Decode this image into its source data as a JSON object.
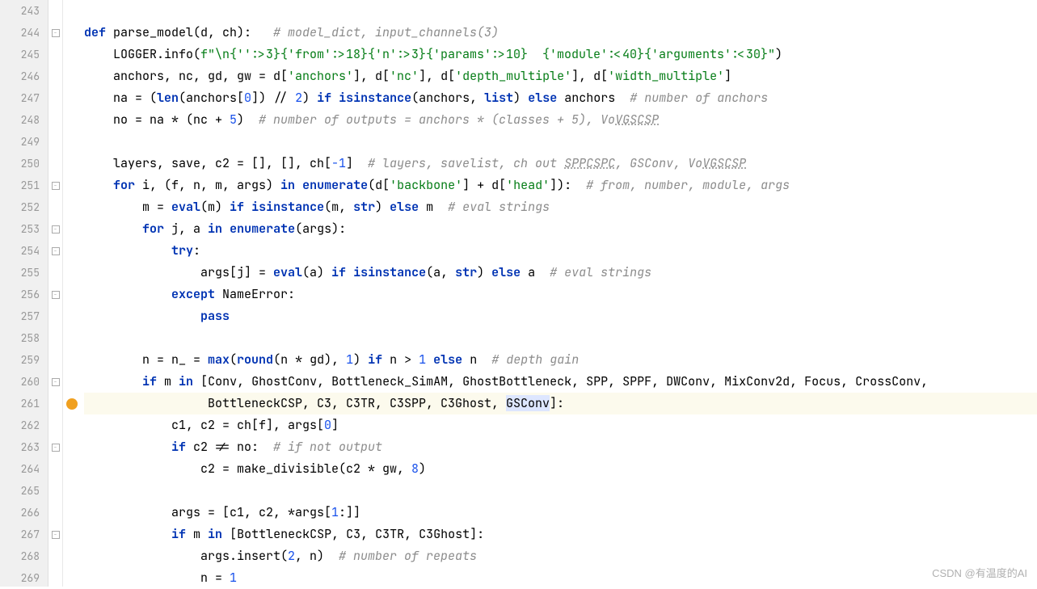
{
  "watermark": "CSDN @有温度的AI",
  "lines": [
    {
      "n": "243",
      "fold": "",
      "icon": "",
      "html": ""
    },
    {
      "n": "244",
      "fold": "box",
      "icon": "",
      "html": "<span class='kw'>def </span><span class='fn'>parse_model</span>(d, ch):   <span class='cm'># model_dict, input_channels(3)</span>"
    },
    {
      "n": "245",
      "fold": "",
      "icon": "",
      "html": "    LOGGER.info(<span class='str'>f\"\\n{'':&gt;3}{'from':&gt;18}{'n':&gt;3}{'params':&gt;10}  {'module':&lt;40}{'arguments':&lt;30}\"</span>)"
    },
    {
      "n": "246",
      "fold": "",
      "icon": "",
      "html": "    anchors, nc, gd, gw = d[<span class='str'>'anchors'</span>], d[<span class='str'>'nc'</span>], d[<span class='str'>'depth_multiple'</span>], d[<span class='str'>'width_multiple'</span>]"
    },
    {
      "n": "247",
      "fold": "",
      "icon": "",
      "html": "    na = (<span class='kw'>len</span>(anchors[<span class='num'>0</span>]) // <span class='num'>2</span>) <span class='kw'>if </span><span class='kw'>isinstance</span>(anchors, <span class='kw'>list</span>) <span class='kw'>else </span>anchors  <span class='cm'># number of anchors</span>"
    },
    {
      "n": "248",
      "fold": "",
      "icon": "",
      "html": "    no = na * (nc + <span class='num'>5</span>)  <span class='cm'># number of outputs = anchors * (classes + 5), Vo<span class='cm-u'>VGSCSP</span></span>"
    },
    {
      "n": "249",
      "fold": "",
      "icon": "",
      "html": ""
    },
    {
      "n": "250",
      "fold": "",
      "icon": "",
      "html": "    layers, save, c2 = [], [], ch[<span class='num'>-1</span>]  <span class='cm'># layers, savelist, ch out <span class='cm-u'>SPPCSPC</span>, GSConv, Vo<span class='cm-u'>VGSCSP</span></span>"
    },
    {
      "n": "251",
      "fold": "box",
      "icon": "",
      "html": "    <span class='kw'>for </span>i, (f, n, m, args) <span class='kw'>in </span><span class='kw'>enumerate</span>(d[<span class='str'>'backbone'</span>] + d[<span class='str'>'head'</span>]):  <span class='cm'># from, number, module, args</span>"
    },
    {
      "n": "252",
      "fold": "",
      "icon": "",
      "html": "        m = <span class='kw'>eval</span>(m) <span class='kw'>if </span><span class='kw'>isinstance</span>(m, <span class='kw'>str</span>) <span class='kw'>else </span>m  <span class='cm'># eval strings</span>"
    },
    {
      "n": "253",
      "fold": "box",
      "icon": "",
      "html": "        <span class='kw'>for </span>j, a <span class='kw'>in </span><span class='kw'>enumerate</span>(args):"
    },
    {
      "n": "254",
      "fold": "box",
      "icon": "",
      "html": "            <span class='kw'>try</span>:"
    },
    {
      "n": "255",
      "fold": "",
      "icon": "",
      "html": "                args[j] = <span class='kw'>eval</span>(a) <span class='kw'>if </span><span class='kw'>isinstance</span>(a, <span class='kw'>str</span>) <span class='kw'>else </span>a  <span class='cm'># eval strings</span>"
    },
    {
      "n": "256",
      "fold": "box",
      "icon": "",
      "html": "            <span class='kw'>except </span>NameError:"
    },
    {
      "n": "257",
      "fold": "",
      "icon": "",
      "html": "                <span class='kw'>pass</span>"
    },
    {
      "n": "258",
      "fold": "",
      "icon": "",
      "html": ""
    },
    {
      "n": "259",
      "fold": "",
      "icon": "",
      "html": "        n = n_ = <span class='kw'>max</span>(<span class='kw'>round</span>(n * gd), <span class='num'>1</span>) <span class='kw'>if </span>n &gt; <span class='num'>1</span> <span class='kw'>else </span>n  <span class='cm'># depth gain</span>"
    },
    {
      "n": "260",
      "fold": "box",
      "icon": "",
      "html": "        <span class='kw'>if </span>m <span class='kw'>in </span>[Conv, GhostConv, Bottleneck_SimAM, GhostBottleneck, SPP, SPPF, DWConv, MixConv2d, Focus, CrossConv,"
    },
    {
      "n": "261",
      "fold": "",
      "icon": "bulb",
      "hl": true,
      "html": "                 BottleneckCSP, C3, C3TR, C3SPP, C3Ghost, <span class='sel'>GSConv</span>]:"
    },
    {
      "n": "262",
      "fold": "",
      "icon": "",
      "html": "            c1, c2 = ch[f], args[<span class='num'>0</span>]"
    },
    {
      "n": "263",
      "fold": "box",
      "icon": "",
      "html": "            <span class='kw'>if </span>c2 != no:  <span class='cm'># if not output</span>"
    },
    {
      "n": "264",
      "fold": "",
      "icon": "",
      "html": "                c2 = make_divisible(c2 * gw, <span class='num'>8</span>)"
    },
    {
      "n": "265",
      "fold": "",
      "icon": "",
      "html": ""
    },
    {
      "n": "266",
      "fold": "",
      "icon": "",
      "html": "            args = [c1, c2, *args[<span class='num'>1</span>:]]"
    },
    {
      "n": "267",
      "fold": "box",
      "icon": "",
      "html": "            <span class='kw'>if </span>m <span class='kw'>in </span>[BottleneckCSP, C3, C3TR, C3Ghost]:"
    },
    {
      "n": "268",
      "fold": "",
      "icon": "",
      "html": "                args.insert(<span class='num'>2</span>, n)  <span class='cm'># number of repeats</span>"
    },
    {
      "n": "269",
      "fold": "",
      "icon": "",
      "html": "                n = <span class='num'>1</span>"
    }
  ]
}
